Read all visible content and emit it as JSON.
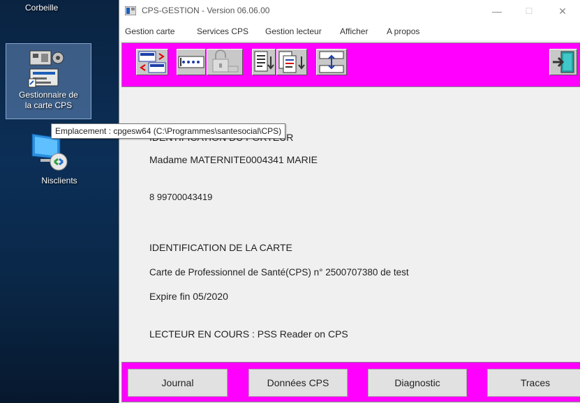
{
  "desktop": {
    "recycle_bin_label": "Corbeille",
    "cps_shortcut_label_line1": "Gestionnaire de",
    "cps_shortcut_label_line2": "la carte CPS",
    "nisclients_label": "Nisclients"
  },
  "tooltip": {
    "text": "Emplacement : cpgesw64 (C:\\Programmes\\santesocial\\CPS)"
  },
  "window": {
    "title": "CPS-GESTION - Version 06.06.00",
    "controls": {
      "minimize": "—",
      "maximize": "☐",
      "close": "✕"
    },
    "menu": [
      "Gestion carte",
      "Services CPS",
      "Gestion lecteur",
      "Afficher",
      "A propos"
    ]
  },
  "toolbar": {
    "buttons": [
      "read-card-icon",
      "pin-code-icon",
      "unlock-card-icon",
      "document-list-icon",
      "document-export-icon",
      "sync-icon",
      "exit-door-icon"
    ]
  },
  "content": {
    "section1_heading": "IDENTIFICATION DU PORTEUR",
    "holder_name": "Madame MATERNITE0004341 MARIE",
    "holder_number": "8 99700043419",
    "section2_heading": "IDENTIFICATION DE LA CARTE",
    "card_description": "Carte de Professionnel de Santé(CPS) n° 2500707380 de test",
    "expiry": "Expire fin 05/2020",
    "reader_status": "LECTEUR EN COURS : PSS Reader on CPS"
  },
  "bottom_buttons": {
    "journal": "Journal",
    "donnees": "Données CPS",
    "diagnostic": "Diagnostic",
    "traces": "Traces"
  },
  "colors": {
    "toolbar_bg": "#ff00ff",
    "window_bg": "#f0f0f0",
    "desktop_bg": "#0b2646"
  }
}
